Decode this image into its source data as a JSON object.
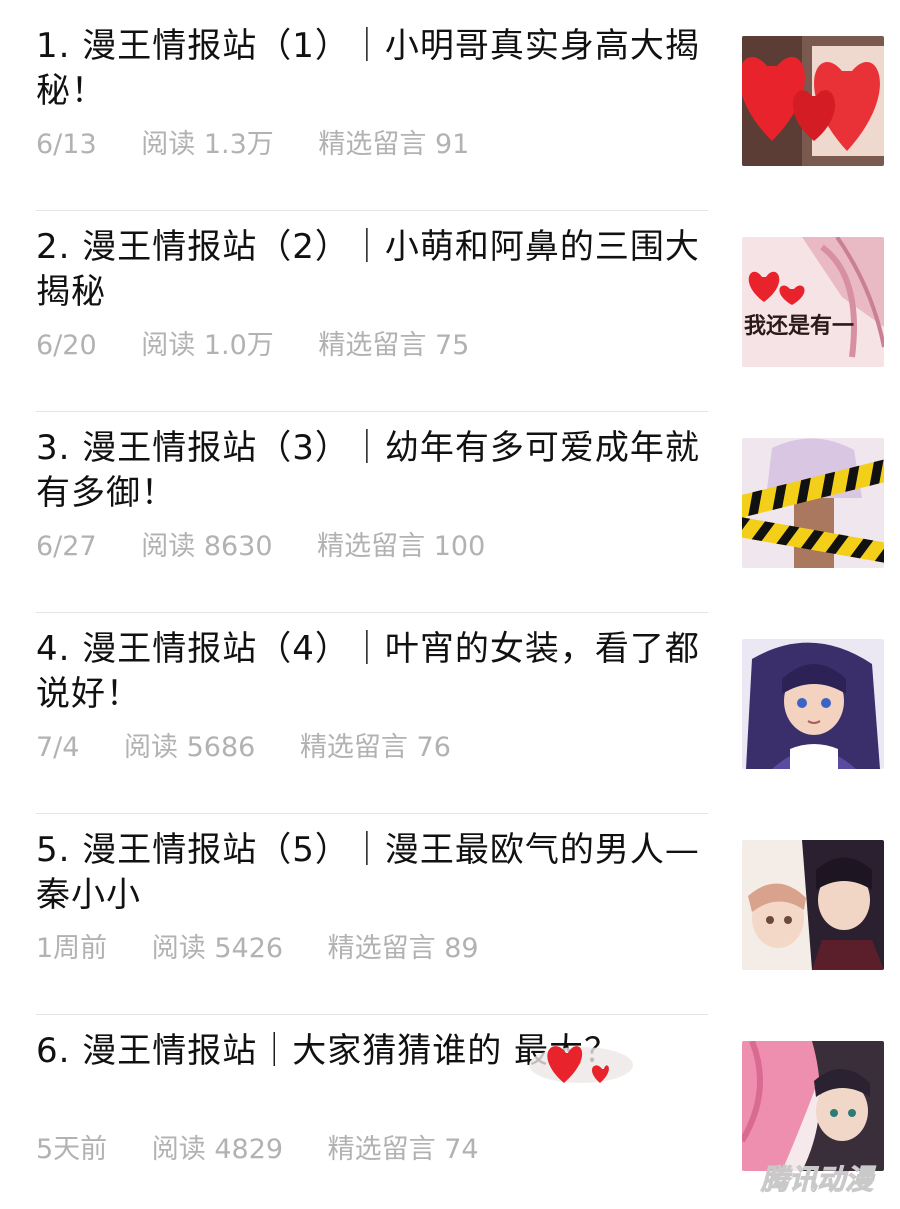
{
  "articles": [
    {
      "title": "1. 漫王情报站（1）｜小明哥真实身高大揭秘！",
      "date": "6/13",
      "reads": "阅读 1.3万",
      "comments": "精选留言 91",
      "thumb_icon": "article-thumbnail-hearts"
    },
    {
      "title": "2. 漫王情报站（2）｜小萌和阿鼻的三围大揭秘",
      "date": "6/20",
      "reads": "阅读 1.0万",
      "comments": "精选留言 75",
      "thumb_icon": "article-thumbnail-comic",
      "thumb_text": "我还是有一"
    },
    {
      "title": "3. 漫王情报站（3）｜幼年有多可爱成年就有多御！",
      "date": "6/27",
      "reads": "阅读 8630",
      "comments": "精选留言 100",
      "thumb_icon": "article-thumbnail-caution-tape"
    },
    {
      "title": "4. 漫王情报站（4）｜叶宵的女装，看了都说好！",
      "date": "7/4",
      "reads": "阅读 5686",
      "comments": "精选留言 76",
      "thumb_icon": "article-thumbnail-character"
    },
    {
      "title": "5. 漫王情报站（5）｜漫王最欧气的男人—秦小小",
      "date": "1周前",
      "reads": "阅读 5426",
      "comments": "精选留言 89",
      "thumb_icon": "article-thumbnail-couple"
    },
    {
      "title": "6. 漫王情报站｜大家猜猜谁的    最大？",
      "date": "5天前",
      "reads": "阅读 4829",
      "comments": "精选留言 74",
      "thumb_icon": "article-thumbnail-pink-hair"
    }
  ],
  "watermark": "腾讯动漫",
  "colors": {
    "meta_text": "#b2b2b2",
    "heart_red": "#e8232b",
    "divider": "#e4e4e4"
  }
}
